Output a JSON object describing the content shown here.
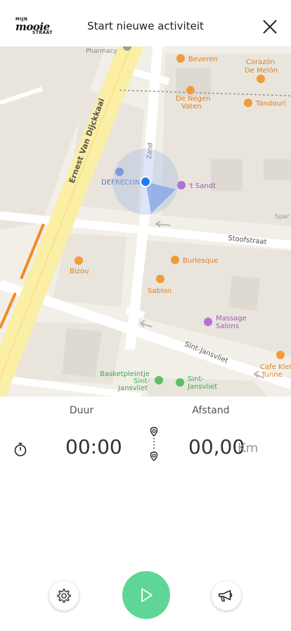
{
  "header": {
    "logo": {
      "line1": "MIJN",
      "line2": "mooie",
      "line3": "STRAAT"
    },
    "title": "Start nieuwe activiteit"
  },
  "map": {
    "labels": {
      "pharmacy": "Pharmacy",
      "beveren": "Beveren",
      "corazon_1": "Corazón",
      "corazon_2": "De Melón",
      "negen_1": "De Negen",
      "negen_2": "Vaten",
      "tandouri": "Tandouri",
      "street_ernest": "Ernest Van Dijckkaai",
      "street_zand": "Zand",
      "defrecon": "DEFRECON",
      "sandt": "'t Sandt",
      "spar": "Spar",
      "street_stoof": "Stoofstraat",
      "bizou": "Bizou",
      "burlesque": "Burlesque",
      "sablon": "Sablon",
      "massage_1": "Massage",
      "massage_2": "Salons",
      "street_sint": "Sint-Jansvliet",
      "cafe_1": "Cafe Klei",
      "cafe_2": "Tunne",
      "basket_1": "Basketpleintje",
      "basket_2": "Sint-",
      "basket_3": "Jansvliet",
      "sintj_1": "Sint-",
      "sintj_2": "Jansvliet"
    }
  },
  "stats": {
    "duration_label": "Duur",
    "distance_label": "Afstand",
    "duration_value": "00:00",
    "distance_value": "00,00",
    "distance_unit": "Km"
  },
  "icons": {
    "close": "close-icon",
    "stopwatch": "stopwatch-icon",
    "route": "route-icon",
    "settings": "gear-icon",
    "play": "play-icon",
    "report": "megaphone-icon"
  },
  "colors": {
    "accent": "#5fd697",
    "location": "#1f7cf0",
    "poi_orange": "#f29b3a",
    "poi_purple": "#b56fd6",
    "poi_green": "#5cbf6b"
  }
}
